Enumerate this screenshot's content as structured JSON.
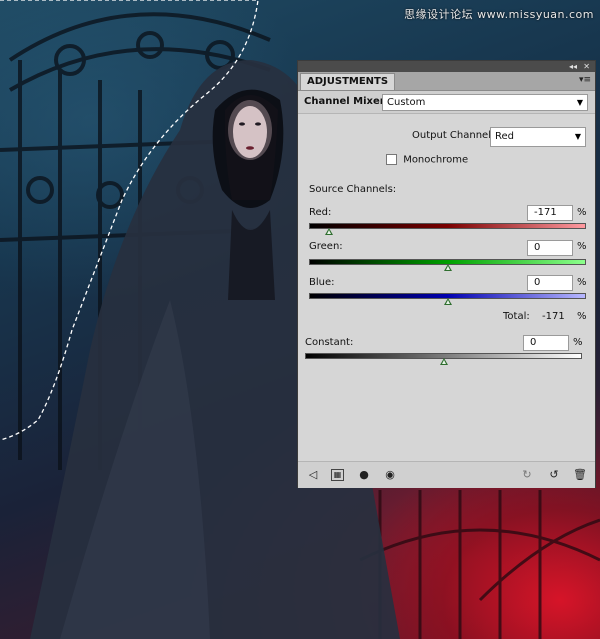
{
  "watermark": "思缘设计论坛 www.missyuan.com",
  "panel": {
    "tab_label": "ADJUSTMENTS",
    "collapse_glyph": "◂◂",
    "close_glyph": "✕",
    "menu_glyph": "▾≡",
    "adjustment_title": "Channel Mixer",
    "preset": {
      "value": "Custom"
    },
    "output_channel": {
      "label": "Output Channel:",
      "value": "Red"
    },
    "monochrome": {
      "label": "Monochrome",
      "checked": false
    },
    "source_channels_label": "Source Channels:",
    "channels": [
      {
        "name": "Red:",
        "value": "-171",
        "unit": "%",
        "slider_percent": -171
      },
      {
        "name": "Green:",
        "value": "0",
        "unit": "%",
        "slider_percent": 0
      },
      {
        "name": "Blue:",
        "value": "0",
        "unit": "%",
        "slider_percent": 0
      }
    ],
    "total": {
      "label": "Total:",
      "value": "-171",
      "unit": "%"
    },
    "constant": {
      "label": "Constant:",
      "value": "0",
      "unit": "%",
      "slider_percent": 0
    },
    "bottom_icons": [
      "back-arrow-icon",
      "clip-to-layer-icon",
      "layer-visibility-mask-icon",
      "eye-icon",
      "previous-state-icon",
      "reset-icon",
      "trash-icon"
    ]
  },
  "colors": {
    "panel_bg": "#d6d6d6",
    "panel_border": "#3b3b3b",
    "thumb": "#2f6e2f"
  }
}
